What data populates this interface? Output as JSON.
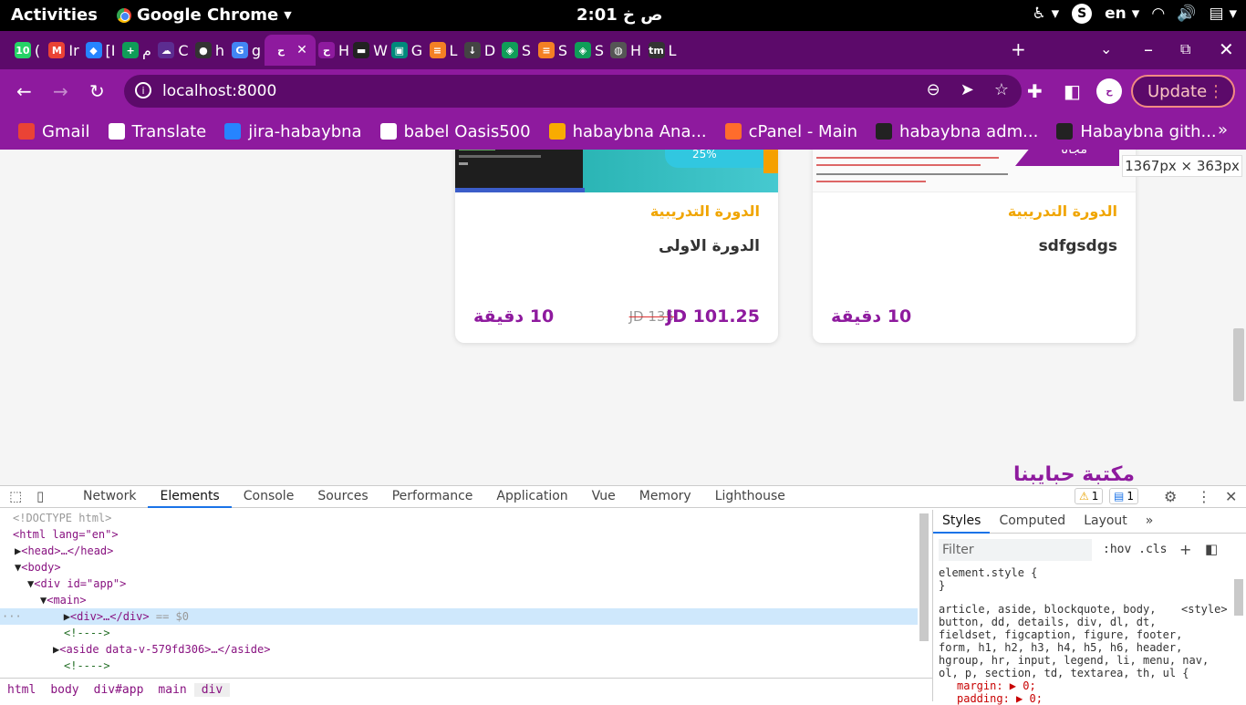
{
  "topbar": {
    "activities": "Activities",
    "app_name": "Google Chrome",
    "clock": "2:01 ص خ",
    "language": "en"
  },
  "tabs": [
    {
      "label": "(",
      "color": "#25d366",
      "glyph": "10"
    },
    {
      "label": "Ir",
      "color": "#ea4335",
      "glyph": "M"
    },
    {
      "label": "[I",
      "color": "#2684ff",
      "glyph": "◆"
    },
    {
      "label": "م",
      "color": "#0f9d58",
      "glyph": "+"
    },
    {
      "label": "C",
      "color": "#5c2d91",
      "glyph": "☁"
    },
    {
      "label": "h",
      "color": "#333333",
      "glyph": "●"
    },
    {
      "label": "g",
      "color": "#4285f4",
      "glyph": "G"
    },
    {
      "label": "",
      "color": "#8e1a9e",
      "glyph": "ح",
      "active": true
    },
    {
      "label": "H",
      "color": "#8e1a9e",
      "glyph": "ح"
    },
    {
      "label": "W",
      "color": "#222222",
      "glyph": "▬"
    },
    {
      "label": "G",
      "color": "#00897b",
      "glyph": "▣"
    },
    {
      "label": "L",
      "color": "#f48024",
      "glyph": "≡"
    },
    {
      "label": "D",
      "color": "#444444",
      "glyph": "↓"
    },
    {
      "label": "S",
      "color": "#0f9d58",
      "glyph": "◈"
    },
    {
      "label": "S",
      "color": "#f48024",
      "glyph": "≡"
    },
    {
      "label": "S",
      "color": "#0f9d58",
      "glyph": "◈"
    },
    {
      "label": "H",
      "color": "#555555",
      "glyph": "◍"
    },
    {
      "label": "L",
      "color": "#333333",
      "glyph": "tm"
    }
  ],
  "address": {
    "url": "localhost:8000",
    "update_label": "Update"
  },
  "bookmarks": [
    {
      "label": "Gmail",
      "color": "#ea4335"
    },
    {
      "label": "Translate",
      "color": "#ffffff"
    },
    {
      "label": "jira-habaybna",
      "color": "#2684ff"
    },
    {
      "label": "babel Oasis500",
      "color": "#ffffff"
    },
    {
      "label": "habaybna Ana...",
      "color": "#f9ab00"
    },
    {
      "label": "cPanel - Main",
      "color": "#ff6c2c"
    },
    {
      "label": "habaybna adm...",
      "color": "#222222"
    },
    {
      "label": "Habaybna gith...",
      "color": "#222222"
    }
  ],
  "page": {
    "dimension_tooltip": "1367px × 363px",
    "library_title": "مكتبة حبايبنا",
    "cards": [
      {
        "category": "الدورة التدريبية",
        "title": "الدورة الاولى",
        "price": "JD 101.25",
        "old_price": "JD 135",
        "duration": "10 دقيقة",
        "badge": "25%"
      },
      {
        "category": "الدورة التدريبية",
        "title": "sdfgsdgs",
        "price": "",
        "old_price": "",
        "duration": "10 دقيقة",
        "badge": "مجانا"
      }
    ]
  },
  "devtools": {
    "tabs": [
      "Network",
      "Elements",
      "Console",
      "Sources",
      "Performance",
      "Application",
      "Vue",
      "Memory",
      "Lighthouse"
    ],
    "active_tab": "Elements",
    "warnings": "1",
    "messages": "1",
    "dom": {
      "doctype": "<!DOCTYPE html>",
      "html_open": "<html lang=\"en\">",
      "head": "<head>…</head>",
      "body": "<body>",
      "div_app": "<div id=\"app\">",
      "main": "<main>",
      "div_selected": "<div>…</div>",
      "selected_marker": "== $0",
      "comment": "<!---->",
      "aside": "<aside data-v-579fd306>…</aside>"
    },
    "breadcrumbs": [
      "html",
      "body",
      "div#app",
      "main",
      "div"
    ],
    "styles_tabs": [
      "Styles",
      "Computed",
      "Layout"
    ],
    "filter_placeholder": "Filter",
    "hov_cls": ":hov .cls",
    "rules": {
      "element_style": "element.style {",
      "close": "}",
      "selector_1": "article, aside, blockquote, body,",
      "source": "<style>",
      "selector_2": "button, dd, details, div, dl, dt,",
      "selector_3": "fieldset, figcaption, figure, footer,",
      "selector_4": "form, h1, h2, h3, h4, h5, h6, header,",
      "selector_5": "hgroup, hr, input, legend, li, menu, nav,",
      "selector_6": "ol, p, section, td, textarea, th, ul {",
      "decl_margin": "margin: ▶ 0;",
      "decl_padding": "padding: ▶ 0;"
    }
  },
  "colors": {
    "brand_purple": "#8e1a9e",
    "brand_dark": "#5c0a6a",
    "accent_orange": "#f0a500"
  }
}
